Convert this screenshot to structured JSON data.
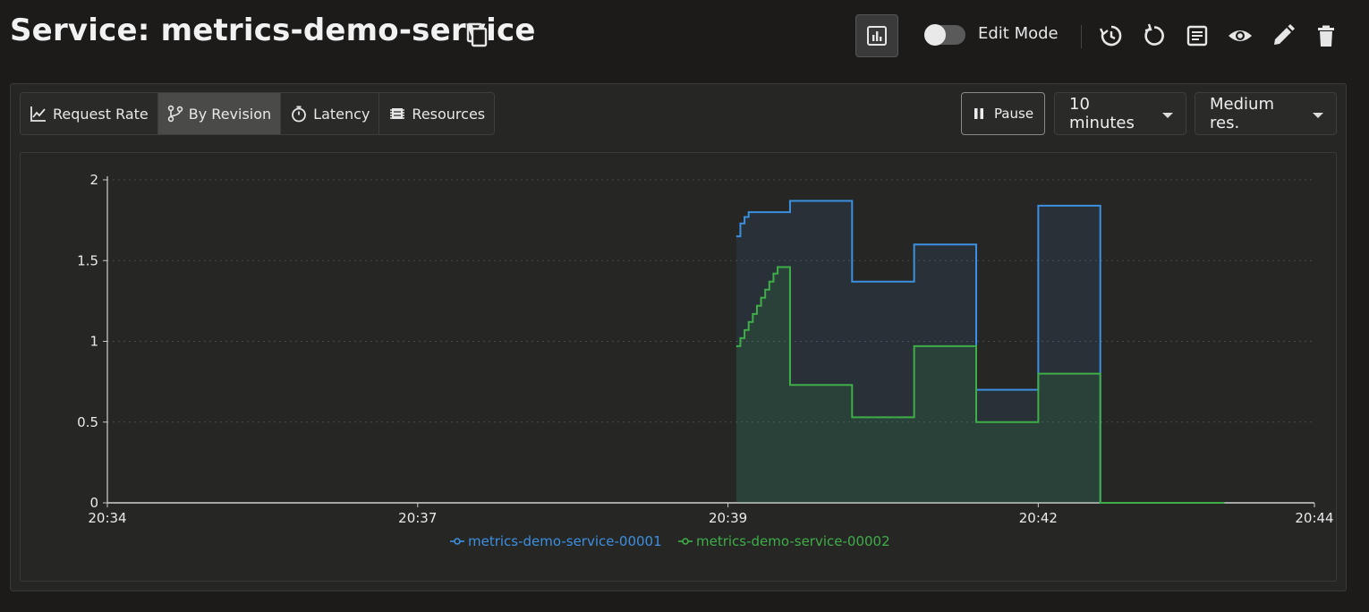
{
  "header": {
    "title": "Service: metrics-demo-service",
    "edit_mode_label": "Edit Mode",
    "edit_mode_on": false
  },
  "tabs": [
    {
      "label": "Request Rate",
      "icon": "line-chart-icon",
      "active": false
    },
    {
      "label": "By Revision",
      "icon": "branch-icon",
      "active": true
    },
    {
      "label": "Latency",
      "icon": "stopwatch-icon",
      "active": false
    },
    {
      "label": "Resources",
      "icon": "memory-chip-icon",
      "active": false
    }
  ],
  "controls": {
    "pause_label": "Pause",
    "time_range": "10 minutes",
    "resolution": "Medium res."
  },
  "colors": {
    "series1": "#3d8fe0",
    "series2": "#3fae49"
  },
  "chart_data": {
    "type": "area",
    "step": true,
    "ylim": [
      0,
      2
    ],
    "y_ticks": [
      "0",
      "0.5",
      "1",
      "1.5",
      "2"
    ],
    "x_ticks": [
      "20:34",
      "20:37",
      "20:39",
      "20:42",
      "20:44"
    ],
    "x_tick_minutes": [
      0,
      3,
      6,
      9,
      11.67
    ],
    "grid": "horizontal dashed",
    "legend": "bottom-center",
    "series": [
      {
        "name": "metrics-demo-service-00001",
        "points": [
          [
            6.08,
            1.65
          ],
          [
            6.12,
            1.73
          ],
          [
            6.16,
            1.77
          ],
          [
            6.2,
            1.8
          ],
          [
            6.6,
            1.87
          ],
          [
            7.2,
            1.37
          ],
          [
            7.8,
            1.6
          ],
          [
            8.4,
            0.7
          ],
          [
            9.0,
            1.84
          ],
          [
            9.6,
            0.0
          ],
          [
            10.8,
            0.0
          ]
        ]
      },
      {
        "name": "metrics-demo-service-00002",
        "points": [
          [
            6.08,
            0.97
          ],
          [
            6.12,
            1.02
          ],
          [
            6.16,
            1.07
          ],
          [
            6.2,
            1.12
          ],
          [
            6.24,
            1.17
          ],
          [
            6.28,
            1.22
          ],
          [
            6.32,
            1.27
          ],
          [
            6.36,
            1.32
          ],
          [
            6.4,
            1.37
          ],
          [
            6.44,
            1.42
          ],
          [
            6.48,
            1.46
          ],
          [
            6.6,
            0.73
          ],
          [
            7.2,
            0.53
          ],
          [
            7.8,
            0.97
          ],
          [
            8.4,
            0.5
          ],
          [
            9.0,
            0.8
          ],
          [
            9.6,
            0.0
          ],
          [
            10.8,
            0.0
          ]
        ]
      }
    ]
  }
}
